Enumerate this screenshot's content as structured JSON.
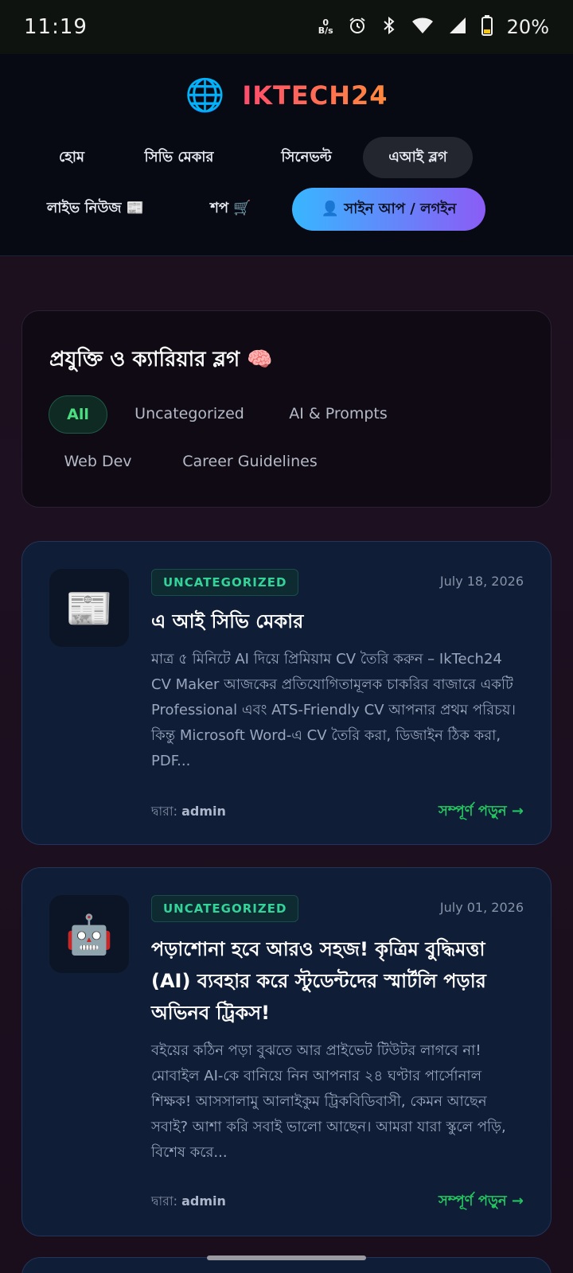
{
  "status_bar": {
    "time": "11:19",
    "net_speed_top": "0",
    "net_speed_bottom": "B/s",
    "battery": "20%"
  },
  "brand": {
    "globe_icon": "🌐",
    "name": "IKTECH24"
  },
  "nav": {
    "home": "হোম",
    "cv_maker": "সিভি মেকার",
    "cinevolt": "সিনেভল্ট",
    "ai_blog": "এআই ব্লগ",
    "live_news": "লাইভ নিউজ 📰",
    "shop": "শপ 🛒",
    "signup": "👤 সাইন আপ / লগইন"
  },
  "blog": {
    "heading": "প্রযুক্তি ও ক্যারিয়ার ব্লগ 🧠",
    "categories": [
      "All",
      "Uncategorized",
      "AI & Prompts",
      "Web Dev",
      "Career Guidelines"
    ]
  },
  "posts": [
    {
      "icon": "📰",
      "category": "UNCATEGORIZED",
      "date": "July 18, 2026",
      "title": "এ আই সিভি মেকার",
      "excerpt": "মাত্র ৫ মিনিটে AI দিয়ে প্রিমিয়াম CV তৈরি করুন – IkTech24 CV Maker আজকের প্রতিযোগিতামূলক চাকরির বাজারে একটি Professional এবং ATS-Friendly CV আপনার প্রথম পরিচয়। কিন্তু Microsoft Word-এ CV তৈরি করা, ডিজাইন ঠিক করা, PDF...",
      "author_prefix": "দ্বারা:",
      "author": "admin",
      "read_more": "সম্পূর্ণ পড়ুন →"
    },
    {
      "icon": "🤖",
      "category": "UNCATEGORIZED",
      "date": "July 01, 2026",
      "title": "পড়াশোনা হবে আরও সহজ! কৃত্রিম বুদ্ধিমত্তা (AI) ব্যবহার করে স্টুডেন্টদের স্মার্টলি পড়ার অভিনব ট্রিকস!",
      "excerpt": "বইয়ের কঠিন পড়া বুঝতে আর প্রাইভেট টিউটর লাগবে না! মোবাইল AI-কে বানিয়ে নিন আপনার ২৪ ঘণ্টার পার্সোনাল শিক্ষক! আসসালামু আলাইকুম ট্রিকবিডিবাসী, কেমন আছেন সবাই? আশা করি সবাই ভালো আছেন। আমরা যারা স্কুলে পড়ি, বিশেষ করে...",
      "author_prefix": "দ্বারা:",
      "author": "admin",
      "read_more": "সম্পূর্ণ পড়ুন →"
    }
  ]
}
